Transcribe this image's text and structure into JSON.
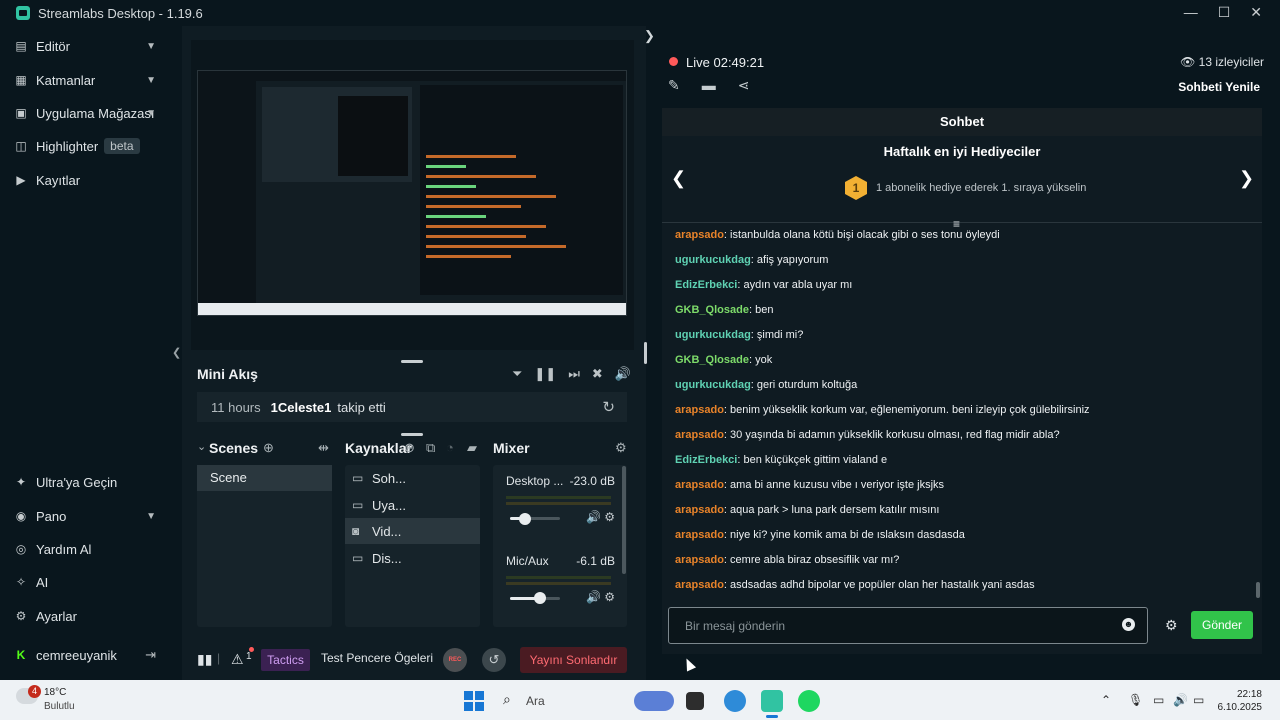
{
  "window": {
    "title": "Streamlabs Desktop - 1.19.6"
  },
  "sidebar": {
    "top_items": [
      {
        "label": "Editör",
        "icon": "editor-icon"
      },
      {
        "label": "Katmanlar",
        "icon": "layers-icon"
      },
      {
        "label": "Uygulama Mağazası",
        "icon": "store-icon"
      },
      {
        "label": "Highlighter",
        "icon": "highlighter-icon",
        "badge": "beta"
      },
      {
        "label": "Kayıtlar",
        "icon": "recordings-icon"
      }
    ],
    "bottom_items": [
      {
        "label": "Ultra'ya Geçin",
        "icon": "ultra-icon"
      },
      {
        "label": "Pano",
        "icon": "dashboard-icon"
      },
      {
        "label": "Yardım Al",
        "icon": "help-icon"
      },
      {
        "label": "AI",
        "icon": "ai-icon"
      },
      {
        "label": "Ayarlar",
        "icon": "settings-icon"
      }
    ],
    "user": {
      "name": "cemreeuyanik"
    }
  },
  "mini_feed": {
    "title": "Mini Akış",
    "event": {
      "time": "11 hours",
      "user": "1Celeste1",
      "action": "takip etti"
    }
  },
  "scenes": {
    "title": "Scenes",
    "items": [
      "Scene"
    ]
  },
  "sources": {
    "title": "Kaynaklar",
    "items": [
      "Soh...",
      "Uya...",
      "Vid...",
      "Dis..."
    ]
  },
  "mixer": {
    "title": "Mixer",
    "channels": [
      {
        "name": "Desktop ...",
        "db": "-23.0 dB",
        "level": 0.3
      },
      {
        "name": "Mic/Aux",
        "db": "-6.1 dB",
        "level": 0.6
      }
    ]
  },
  "bottom_bar": {
    "alert_count": "1",
    "tactics": "Tactics",
    "test_widgets": "Test Pencere Ögeleri",
    "rec": "REC",
    "end_stream": "Yayını Sonlandır"
  },
  "stream": {
    "live_label": "Live",
    "duration": "02:49:21",
    "viewers": "13 izleyiciler",
    "refresh_chat": "Sohbeti Yenile"
  },
  "chat": {
    "header": "Sohbet",
    "gifters_title": "Haftalık en iyi Hediyeciler",
    "gifters_rank": "1",
    "gifters_text": "1 abonelik hediye ederek 1. sıraya yükselin",
    "messages": [
      {
        "user": "arapsado",
        "color": "#e8832a",
        "text": ": istanbulda olana kötü bişi olacak gibi o ses tonu öyleydi"
      },
      {
        "user": "ugurkucukdag",
        "color": "#5fd2b3",
        "text": ": afiş yapıyorum"
      },
      {
        "user": "EdizErbekci",
        "color": "#5fd2b3",
        "text": ": aydın var abla uyar mı"
      },
      {
        "user": "GKB_Qlosade",
        "color": "#7ddb6a",
        "text": ": ben"
      },
      {
        "user": "ugurkucukdag",
        "color": "#5fd2b3",
        "text": ": şimdi mi?"
      },
      {
        "user": "GKB_Qlosade",
        "color": "#7ddb6a",
        "text": ": yok"
      },
      {
        "user": "ugurkucukdag",
        "color": "#5fd2b3",
        "text": ": geri oturdum koltuğa"
      },
      {
        "user": "arapsado",
        "color": "#e8832a",
        "text": ": benim yükseklik korkum var, eğlenemiyorum. beni izleyip çok gülebilirsiniz"
      },
      {
        "user": "arapsado",
        "color": "#e8832a",
        "text": ": 30 yaşında bi adamın yükseklik korkusu olması, red flag midir abla?"
      },
      {
        "user": "EdizErbekci",
        "color": "#5fd2b3",
        "text": ": ben küçükçek gittim vialand e"
      },
      {
        "user": "arapsado",
        "color": "#e8832a",
        "text": ": ama bi anne kuzusu vibe ı veriyor işte jksjks"
      },
      {
        "user": "arapsado",
        "color": "#e8832a",
        "text": ": aqua park > luna park dersem katılır mısını"
      },
      {
        "user": "arapsado",
        "color": "#e8832a",
        "text": ": niye ki? yine komik ama bi de ıslaksın dasdasda"
      },
      {
        "user": "arapsado",
        "color": "#e8832a",
        "text": ": cemre abla biraz obsesiflik var mı?"
      },
      {
        "user": "arapsado",
        "color": "#e8832a",
        "text": ": asdsadas adhd bipolar ve popüler olan her hastalık yani asdas"
      }
    ],
    "input_placeholder": "Bir mesaj gönderin",
    "send_label": "Gönder"
  },
  "taskbar": {
    "weather_badge": "4",
    "temperature": "18°C",
    "weather": "Bulutlu",
    "search": "Ara",
    "time": "22:18",
    "date": "6.10.2025"
  }
}
